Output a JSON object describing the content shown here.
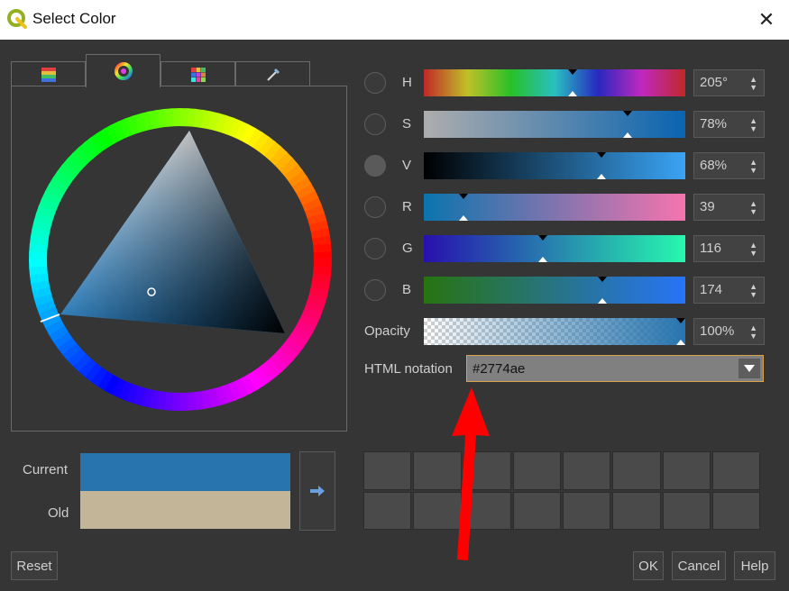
{
  "window": {
    "title": "Select Color",
    "close_glyph": "✕"
  },
  "tabs": [
    {
      "icon": "palette-list-icon",
      "active": false
    },
    {
      "icon": "color-wheel-icon",
      "active": true
    },
    {
      "icon": "swatch-grid-icon",
      "active": false
    },
    {
      "icon": "eyedropper-icon",
      "active": false
    }
  ],
  "color": {
    "hue": 205,
    "saturation": 0.78,
    "value": 0.68,
    "r": 39,
    "g": 116,
    "b": 174,
    "opacity": 1.0,
    "hex": "#2774ae"
  },
  "channels": {
    "h": {
      "label": "H",
      "value": "205°",
      "pos": 0.569
    },
    "s": {
      "label": "S",
      "value": "78%",
      "pos": 0.78
    },
    "v": {
      "label": "V",
      "value": "68%",
      "pos": 0.68
    },
    "r": {
      "label": "R",
      "value": "39",
      "pos": 0.153
    },
    "g": {
      "label": "G",
      "value": "116",
      "pos": 0.455
    },
    "b": {
      "label": "B",
      "value": "174",
      "pos": 0.682
    }
  },
  "opacity": {
    "label": "Opacity",
    "value": "100%",
    "pos": 1.0
  },
  "html_notation": {
    "label": "HTML notation",
    "value": "#2774ae"
  },
  "preview": {
    "current_label": "Current",
    "old_label": "Old",
    "current_color": "#2774ae",
    "old_color": "#c2b598"
  },
  "buttons": {
    "reset": "Reset",
    "ok": "OK",
    "cancel": "Cancel",
    "help": "Help"
  },
  "colors": {
    "accent_border": "#d9a14a",
    "annotation_arrow": "#ff0000"
  }
}
